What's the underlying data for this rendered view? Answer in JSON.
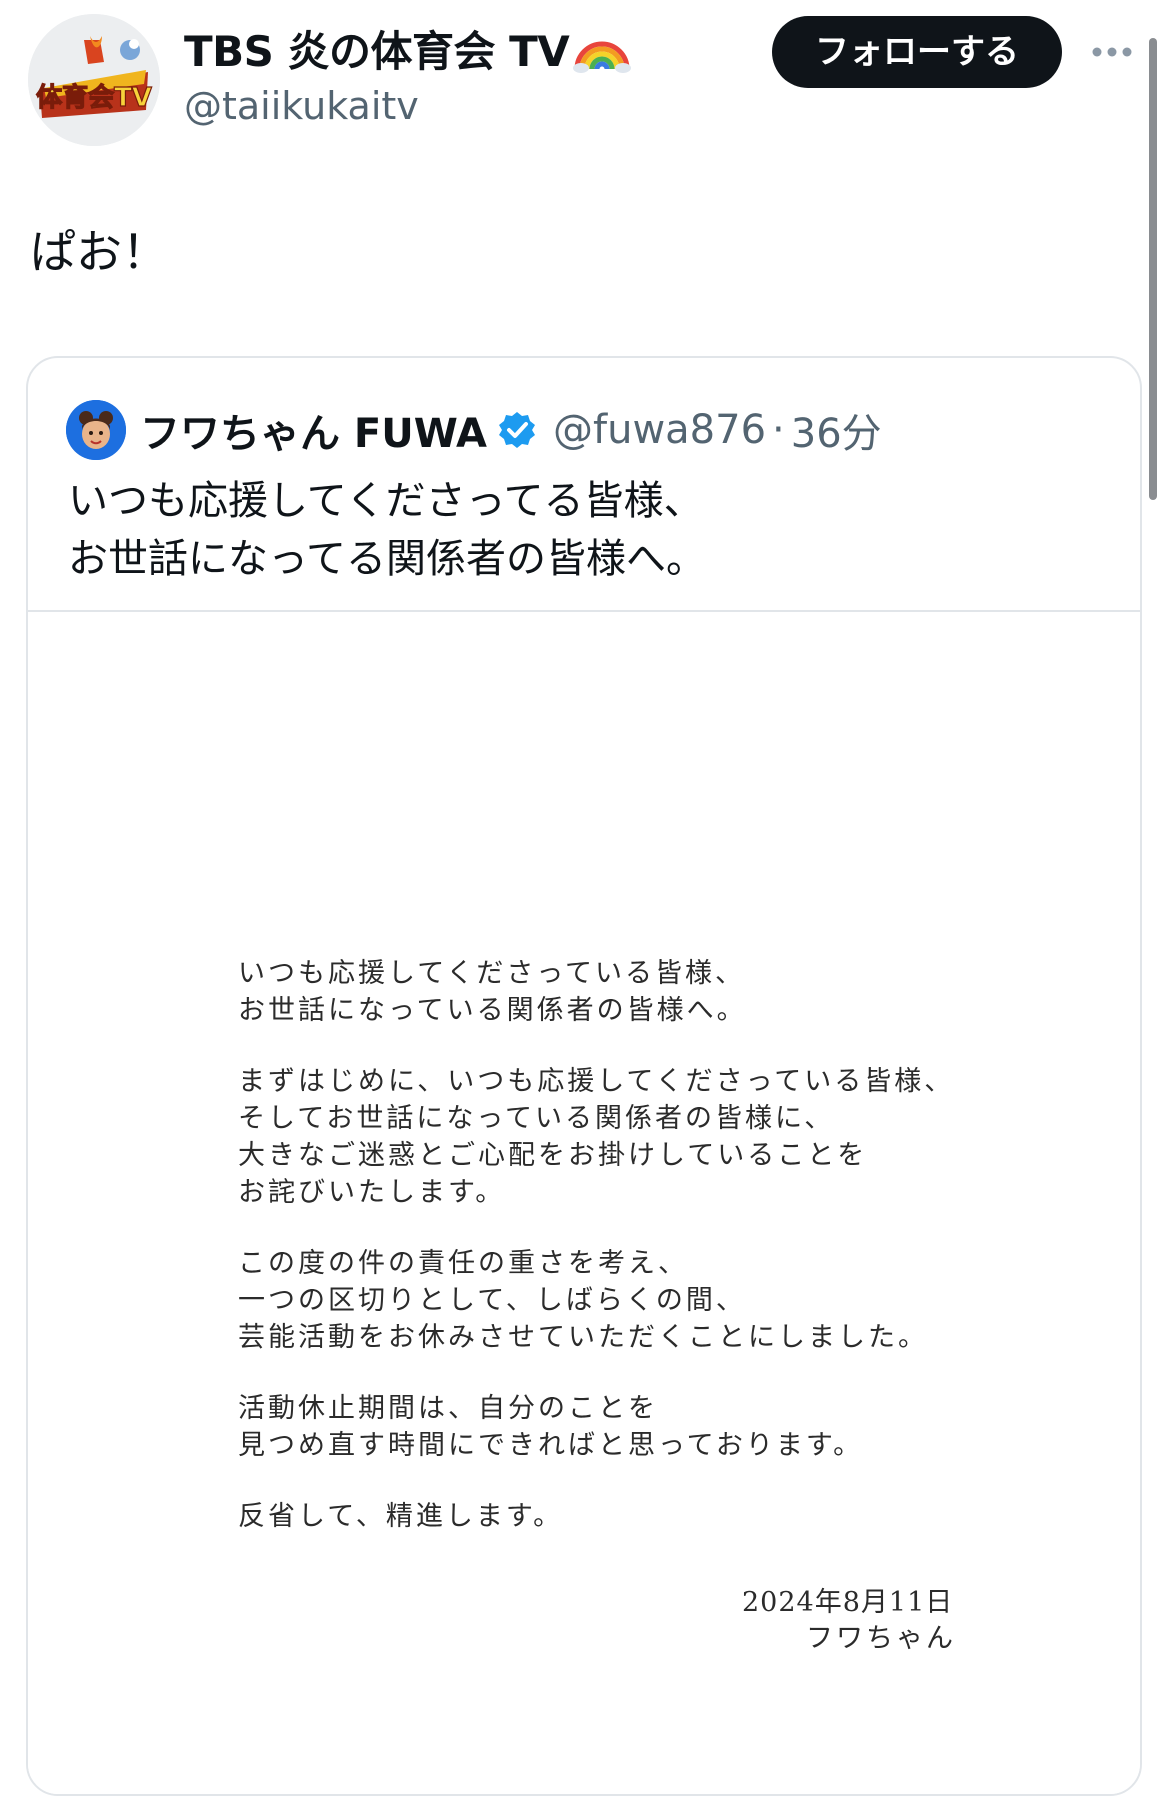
{
  "author": {
    "display_name": "TBS 炎の体育会 TV",
    "emoji": "rainbow",
    "handle": "@taiikukaitv",
    "avatar_logo_text": "体育会TV"
  },
  "actions": {
    "follow_label": "フォローする",
    "more_icon": "more-horizontal-icon"
  },
  "tweet": {
    "text": "ぱお！"
  },
  "quote": {
    "display_name": "フワちゃん FUWA",
    "verified": true,
    "handle": "@fuwa876",
    "separator": "·",
    "time": "36分",
    "text_lines": [
      "いつも応援してくださってる皆様、",
      "お世話になってる関係者の皆様へ。"
    ]
  },
  "letter": {
    "paragraphs": [
      [
        "いつも応援してくださっている皆様、",
        "お世話になっている関係者の皆様へ。"
      ],
      [
        "まずはじめに、いつも応援してくださっている皆様、",
        "そしてお世話になっている関係者の皆様に、",
        "大きなご迷惑とご心配をお掛けしていることを",
        "お詫びいたします。"
      ],
      [
        "この度の件の責任の重さを考え、",
        "一つの区切りとして、しばらくの間、",
        "芸能活動をお休みさせていただくことにしました。"
      ],
      [
        "活動休止期間は、自分のことを",
        "見つめ直す時間にできればと思っております。"
      ],
      [
        "反省して、精進します。"
      ]
    ],
    "date": "2024年8月11日",
    "signature": "フワちゃん"
  },
  "colors": {
    "text_primary": "#0f1419",
    "text_secondary": "#536471",
    "follow_bg": "#0f1419",
    "verified_blue": "#1d9bf0",
    "border": "#e1e5e9"
  }
}
